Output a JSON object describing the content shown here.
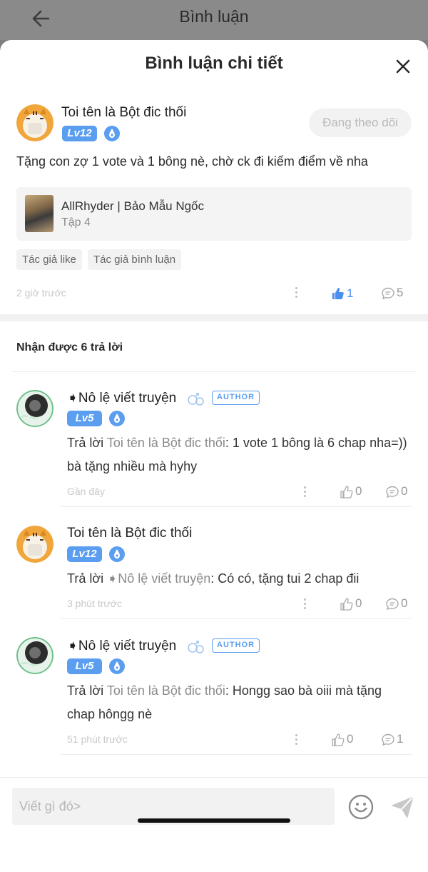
{
  "header": {
    "title": "Bình luận",
    "back_icon": "arrow-left-icon"
  },
  "sheet": {
    "title": "Bình luận chi tiết",
    "close_icon": "close-icon"
  },
  "comment": {
    "user": "Toi tên là Bột đic thối",
    "level": "Lv12",
    "follow_label": "Đang theo dõi",
    "text": "Tặng con zợ 1 vote và 1 bông nè, chờ ck đi kiếm điểm về nha",
    "story": {
      "title": "AllRhyder | Bảo Mẫu Ngốc",
      "episode": "Tập 4"
    },
    "tags": [
      "Tác giả like",
      "Tác giả bình luận"
    ],
    "time": "2 giờ trước",
    "likes": "1",
    "comments": "5"
  },
  "replies_header": "Nhận được 6 trả lời",
  "replies": [
    {
      "user": "➧Nô lệ viết truyện",
      "badge": "AUTHOR",
      "level": "Lv5",
      "prefix": "Trả lời ",
      "ref": "Toi tên là Bột đic thối",
      "body": ": 1 vote 1 bông là 6 chap nha=)) bà tặng nhiều mà hyhy",
      "time": "Gần đây",
      "likes": "0",
      "comments": "0"
    },
    {
      "user": "Toi tên là Bột đic thối",
      "badge": "",
      "level": "Lv12",
      "prefix": "Trả lời ",
      "ref": "➧Nô lệ viết truyện",
      "body": ": Có có, tặng tui 2 chap đii",
      "time": "3 phút trước",
      "likes": "0",
      "comments": "0"
    },
    {
      "user": "➧Nô lệ viết truyện",
      "badge": "AUTHOR",
      "level": "Lv5",
      "prefix": "Trả lời ",
      "ref": "Toi tên là Bột đic thối",
      "body": ": Hongg sao bà oiii mà tặng chap hôngg nè",
      "time": "51 phút trước",
      "likes": "0",
      "comments": "1"
    }
  ],
  "composer": {
    "placeholder": "Viết gì đó>",
    "emoji_icon": "smile-icon",
    "send_icon": "send-icon"
  },
  "colors": {
    "accent": "#5b9ef0",
    "like_active": "#4a8ef0",
    "overlay": "#808080"
  }
}
